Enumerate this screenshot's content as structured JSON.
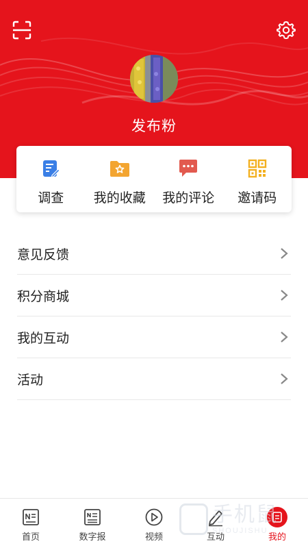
{
  "colors": {
    "brand_red": "#e5141c",
    "text": "#222222",
    "divider": "#e8e8e8"
  },
  "header": {
    "scan_icon": "scan-icon",
    "settings_icon": "gear-icon"
  },
  "profile": {
    "username": "发布粉"
  },
  "quick_actions": [
    {
      "label": "调查",
      "icon": "survey-edit-icon",
      "color": "#3a7fe6"
    },
    {
      "label": "我的收藏",
      "icon": "favorites-folder-icon",
      "color": "#f3a531"
    },
    {
      "label": "我的评论",
      "icon": "comment-bubble-icon",
      "color": "#e25a4f"
    },
    {
      "label": "邀请码",
      "icon": "qr-code-icon",
      "color": "#f3b020"
    }
  ],
  "menu": [
    {
      "label": "意见反馈"
    },
    {
      "label": "积分商城"
    },
    {
      "label": "我的互动"
    },
    {
      "label": "活动"
    }
  ],
  "tabbar": [
    {
      "label": "首页",
      "icon": "home-news-icon",
      "active": false
    },
    {
      "label": "数字报",
      "icon": "digital-newspaper-icon",
      "active": false
    },
    {
      "label": "视频",
      "icon": "video-play-icon",
      "active": false
    },
    {
      "label": "互动",
      "icon": "pen-edit-icon",
      "active": false
    },
    {
      "label": "我的",
      "icon": "profile-icon",
      "active": true
    }
  ],
  "watermark": {
    "cn": "手机鼠",
    "en": "SHOUJISHU"
  }
}
